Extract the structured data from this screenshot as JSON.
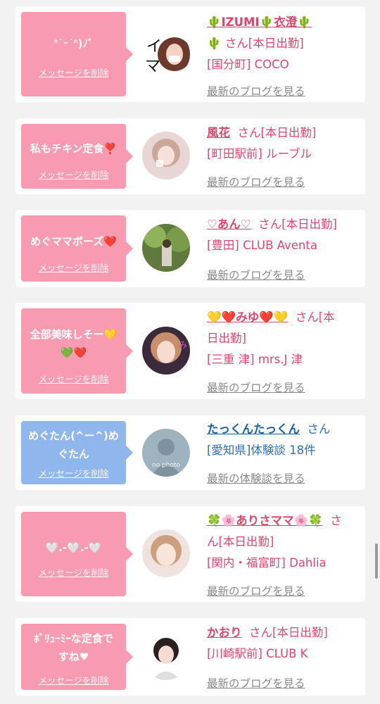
{
  "delete_label": "メッセージを削除",
  "blog_label": "最新のブログを見る",
  "taiken_label": "最新の体験談を見る",
  "colors": {
    "pink_bubble": "#f89bb0",
    "blue_bubble": "#8fb7ee",
    "name_pink": "#e0456c",
    "name_blue": "#1b5ea8"
  },
  "items": [
    {
      "message": "ᐢ˙ᵕ˙ᐢ)ﾉﾞ",
      "name": "🌵IZUMI🌵衣澄🌵",
      "line1_tail": "🌵 さん[本日出勤]",
      "line2": "[国分町] COCO",
      "link": "最新のブログを見る",
      "avatar": "avatar-icon-izumi"
    },
    {
      "message": "私もチキン定食❣️",
      "name": "風花",
      "line1_tail": "さん[本日出勤]",
      "line2": "[町田駅前] ルーブル",
      "link": "最新のブログを見る",
      "avatar": "avatar-icon-fuka"
    },
    {
      "message": "めぐママポーズ❤️",
      "name": "♡あん♡",
      "line1_tail": "さん[本日出勤]",
      "line2": "[豊田] CLUB Aventa",
      "link": "最新のブログを見る",
      "avatar": "avatar-icon-an"
    },
    {
      "message": "全部美味しそー💛\n💚❤️",
      "name": "💛❤️みゆ❤️💛",
      "line1_tail": "さん[本",
      "line1b": "日出勤]",
      "line2": "[三重 津] mrs.J 津",
      "link": "最新のブログを見る",
      "avatar": "avatar-icon-miyu"
    },
    {
      "message": "めぐたん(^ー^)め\nぐたん",
      "name": "たっくんたっくん",
      "line1_tail": "さん",
      "line2": "[愛知県]体験談 18件",
      "link": "最新の体験談を見る",
      "avatar_text": "no photo",
      "avatar": "no-photo-icon"
    },
    {
      "message": "🤍.-🤍.-🤍",
      "name": "🍀🌸ありさママ🌸🍀",
      "line1_tail": "さ",
      "line1b": "ん[本日出勤]",
      "line2": "[関内・福富町] Dahlia",
      "link": "最新のブログを見る",
      "avatar": "avatar-icon-arisa"
    },
    {
      "message": "ﾎﾞﾘｭｰﾐｰな定食で\nすね♥",
      "name": "かおり",
      "line1_tail": "さん[本日出勤]",
      "line2": "[川崎駅前] CLUB K",
      "link": "最新のブログを見る",
      "avatar": "avatar-icon-kaori"
    }
  ]
}
